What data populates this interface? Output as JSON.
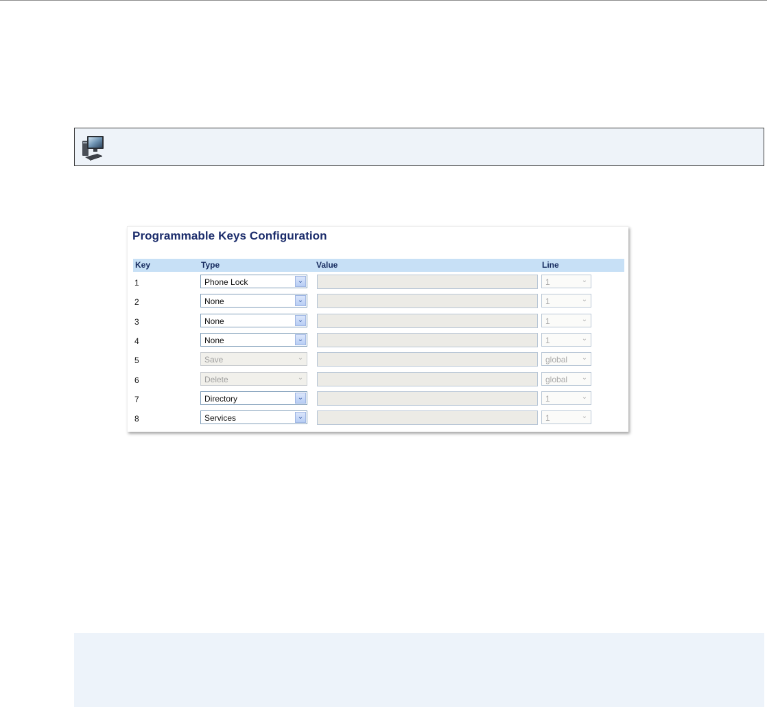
{
  "panel": {
    "title": "Programmable Keys Configuration",
    "headers": {
      "key": "Key",
      "type": "Type",
      "value": "Value",
      "line": "Line"
    },
    "rows": [
      {
        "key": "1",
        "type": "Phone Lock",
        "type_enabled": true,
        "value": "",
        "line": "1"
      },
      {
        "key": "2",
        "type": "None",
        "type_enabled": true,
        "value": "",
        "line": "1"
      },
      {
        "key": "3",
        "type": "None",
        "type_enabled": true,
        "value": "",
        "line": "1"
      },
      {
        "key": "4",
        "type": "None",
        "type_enabled": true,
        "value": "",
        "line": "1"
      },
      {
        "key": "5",
        "type": "Save",
        "type_enabled": false,
        "value": "",
        "line": "global"
      },
      {
        "key": "6",
        "type": "Delete",
        "type_enabled": false,
        "value": "",
        "line": "global"
      },
      {
        "key": "7",
        "type": "Directory",
        "type_enabled": true,
        "value": "",
        "line": "1"
      },
      {
        "key": "8",
        "type": "Services",
        "type_enabled": true,
        "value": "",
        "line": "1"
      }
    ]
  },
  "icons": {
    "info_bar": "computer-monitor-icon",
    "dropdown": "chevron-down-icon"
  },
  "colors": {
    "title": "#1b2c6b",
    "header_bg": "#c7e0f6",
    "info_bar_bg": "#eef3f9",
    "note_bg": "#edf3fa"
  }
}
